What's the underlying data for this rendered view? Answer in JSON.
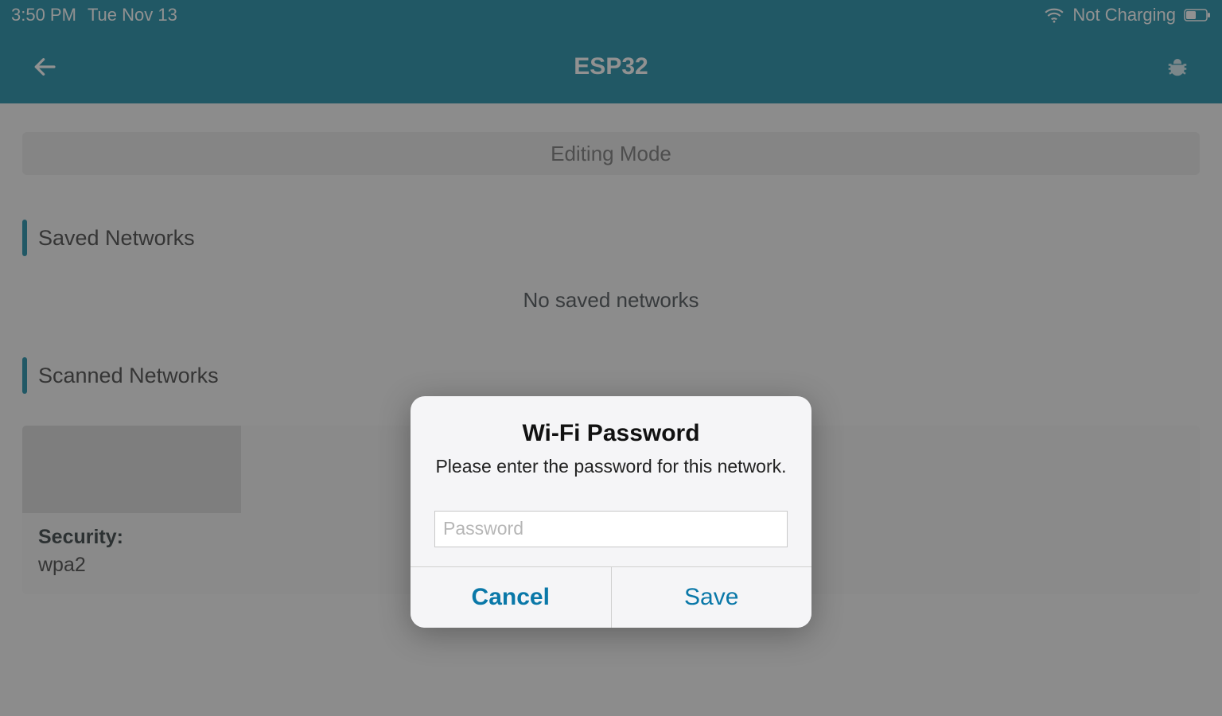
{
  "status": {
    "time": "3:50 PM",
    "date": "Tue Nov 13",
    "charge_text": "Not Charging"
  },
  "nav": {
    "title": "ESP32"
  },
  "banner": {
    "text": "Editing Mode"
  },
  "sections": {
    "saved_title": "Saved Networks",
    "saved_empty": "No saved networks",
    "scanned_title": "Scanned Networks"
  },
  "scanned_item": {
    "security_label": "Security:",
    "security_value": "wpa2"
  },
  "modal": {
    "title": "Wi-Fi Password",
    "message": "Please enter the password for this network.",
    "placeholder": "Password",
    "value": "",
    "cancel": "Cancel",
    "save": "Save"
  },
  "colors": {
    "teal": "#08829e",
    "accent_blue": "#0a78a8"
  }
}
